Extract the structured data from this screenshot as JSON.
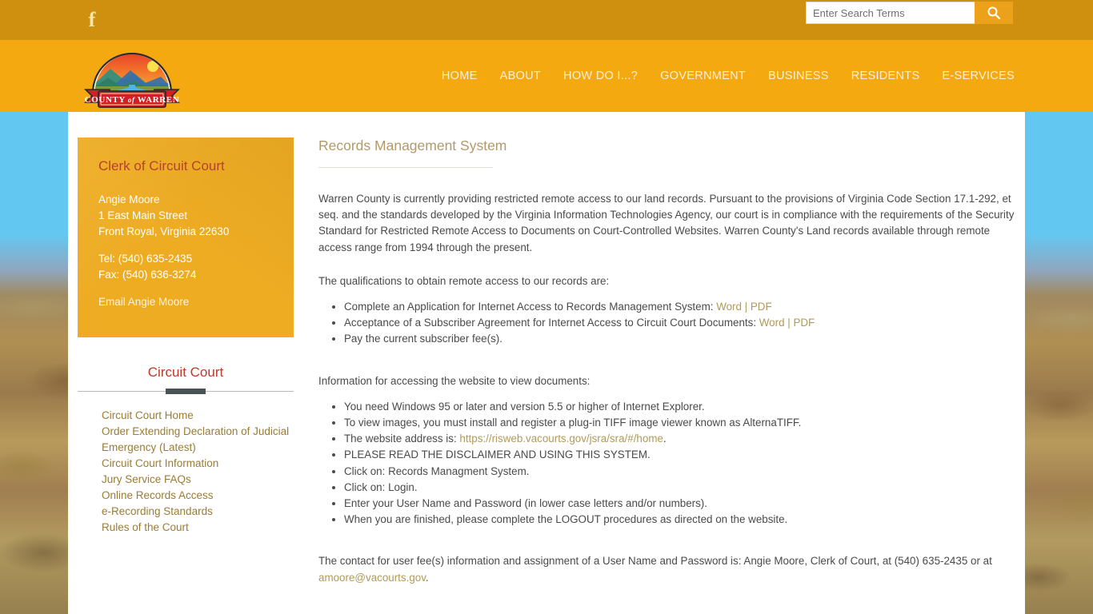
{
  "topbar": {
    "facebook_glyph": "f",
    "facebook_name": "facebook-icon",
    "search": {
      "placeholder": "Enter Search Terms",
      "value": "",
      "button_icon": "search-icon"
    }
  },
  "header": {
    "logo_text_main": "COUNTY",
    "logo_text_of": "of",
    "logo_text_county": "WARREN",
    "nav": [
      {
        "label": "HOME"
      },
      {
        "label": "ABOUT"
      },
      {
        "label": "HOW DO I...?"
      },
      {
        "label": "GOVERNMENT"
      },
      {
        "label": "BUSINESS"
      },
      {
        "label": "RESIDENTS"
      },
      {
        "label": "E-SERVICES"
      }
    ]
  },
  "sidebar": {
    "contact": {
      "title": "Clerk of Circuit Court",
      "name": "Angie Moore",
      "street": "1 East Main Street",
      "city_state_zip": "Front Royal, Virginia 22630",
      "tel": "Tel: (540) 635-2435",
      "fax": "Fax: (540) 636-3274",
      "email_link": "Email Angie Moore"
    },
    "menu": {
      "title": "Circuit Court",
      "items": [
        {
          "label": "Circuit Court Home"
        },
        {
          "label": "Order Extending Declaration of Judicial Emergency (Latest)"
        },
        {
          "label": "Circuit Court Information"
        },
        {
          "label": "Jury Service FAQs"
        },
        {
          "label": "Online Records Access"
        },
        {
          "label": "e-Recording Standards"
        },
        {
          "label": "Rules of the Court"
        }
      ]
    }
  },
  "main": {
    "title": "Records Management System",
    "intro_paragraph": "Warren County is currently providing restricted remote access to our land records. Pursuant to the provisions of Virginia Code Section 17.1-292, et seq. and the standards developed by the Virginia Information Technologies Agency, our court is in compliance with the requirements of the Security Standard for Restricted Remote Access to Documents on Court-Controlled Websites. Warren County's Land records available through remote access range from 1994 through the present.",
    "qualifications_lead": "The qualifications to obtain remote access to our records are:",
    "qualifications": {
      "item1_text": "Complete an Application for Internet Access to Records Management System: ",
      "item1_word": "Word",
      "item1_sep": " | ",
      "item1_pdf": "PDF",
      "item2_text": "Acceptance of a Subscriber Agreement for Internet Access to Circuit Court Documents: ",
      "item2_word": "Word",
      "item2_sep": " | ",
      "item2_pdf": "PDF",
      "item3_text": "Pay the current subscriber fee(s)."
    },
    "access_lead": "Information for accessing the website to view documents:",
    "access_items": {
      "item1": "You need Windows 95 or later and version 5.5 or higher of Internet Explorer.",
      "item2": "To view images, you must install and register a plug-in TIFF image viewer known as AlternaTIFF.",
      "item3_prefix": "The website address is: ",
      "item3_link": "https://risweb.vacourts.gov/jsra/sra/#/home",
      "item3_suffix": ".",
      "item4": "PLEASE READ THE DISCLAIMER AND USING THIS SYSTEM.",
      "item5": "Click on: Records Managment System.",
      "item6": "Click on: Login.",
      "item7": "Enter your User Name and Password (in lower case letters and/or numbers).",
      "item8": "When you are finished, please complete the LOGOUT procedures as directed on the website."
    },
    "contact_paragraph": {
      "prefix": "The contact for user fee(s) information and assignment of a User Name and Password is: Angie Moore, Clerk of Court, at (540) 635-2435 or at ",
      "email": "amoore@vacourts.gov",
      "suffix": "."
    }
  },
  "colors": {
    "topbar": "#ce900e",
    "header": "#f5a911",
    "card": "#eeac23",
    "link_gold": "#b09a58",
    "menu_link": "#9a7c34",
    "heading_red": "#b5442b",
    "title_tan": "#b09a6b"
  }
}
